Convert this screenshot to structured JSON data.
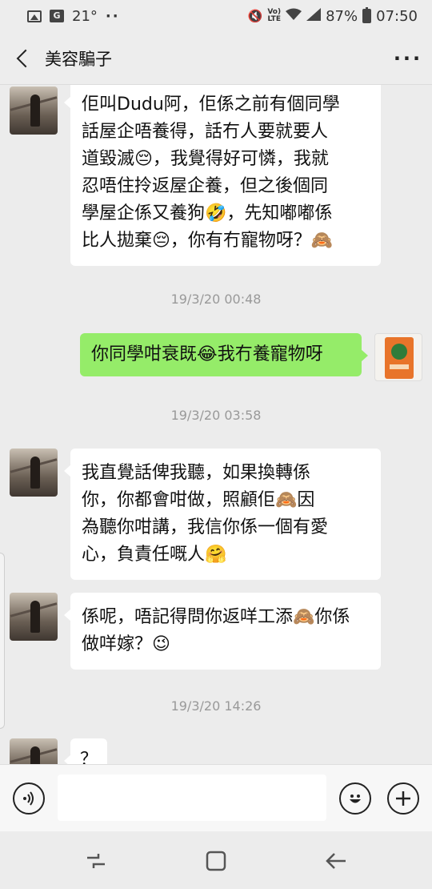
{
  "status_bar": {
    "temperature": "21°",
    "battery": "87%",
    "time": "07:50",
    "network_label": "Vo) LTE",
    "icons": [
      "gallery-icon",
      "gps-icon",
      "more-dots-icon",
      "mute-icon",
      "volte-icon",
      "wifi-icon",
      "signal-icon",
      "battery-icon"
    ]
  },
  "header": {
    "title": "美容騙子",
    "back_icon": "chevron-left-icon",
    "more_icon": "more-icon"
  },
  "messages": [
    {
      "sender": "other",
      "lines": [
        "佢叫Dudu阿，佢係之前有個同學",
        "話屋企唔養得，話冇人要就要人",
        "道毀滅😔，我覺得好可憐，我就",
        "忍唔住拎返屋企養，但之後個同",
        "學屋企係又養狗🤣，先知嘟嘟係",
        "比人拋棄😔，你有冇寵物呀？🙈"
      ]
    },
    {
      "timestamp": "19/3/20 00:48"
    },
    {
      "sender": "self",
      "lines": [
        "你同學咁衰既😂我冇養寵物呀"
      ]
    },
    {
      "timestamp": "19/3/20 03:58"
    },
    {
      "sender": "other",
      "lines": [
        "我直覺話俾我聽，如果換轉係",
        "你，你都會咁做，照顧佢🙈因",
        "為聽你咁講，我信你係一個有愛",
        "心，負責任嘅人🤗"
      ]
    },
    {
      "sender": "other",
      "lines": [
        "係呢，唔記得問你返咩工添🙈你係",
        "做咩嫁？😉"
      ]
    },
    {
      "timestamp": "19/3/20 14:26"
    },
    {
      "sender": "other",
      "lines": [
        "？"
      ]
    }
  ],
  "input_bar": {
    "voice_icon": "voice-icon",
    "emoji_icon": "emoji-icon",
    "add_icon": "plus-icon",
    "placeholder": "",
    "value": ""
  },
  "nav_bar": {
    "icons": [
      "recent-apps-icon",
      "home-icon",
      "back-icon"
    ]
  }
}
